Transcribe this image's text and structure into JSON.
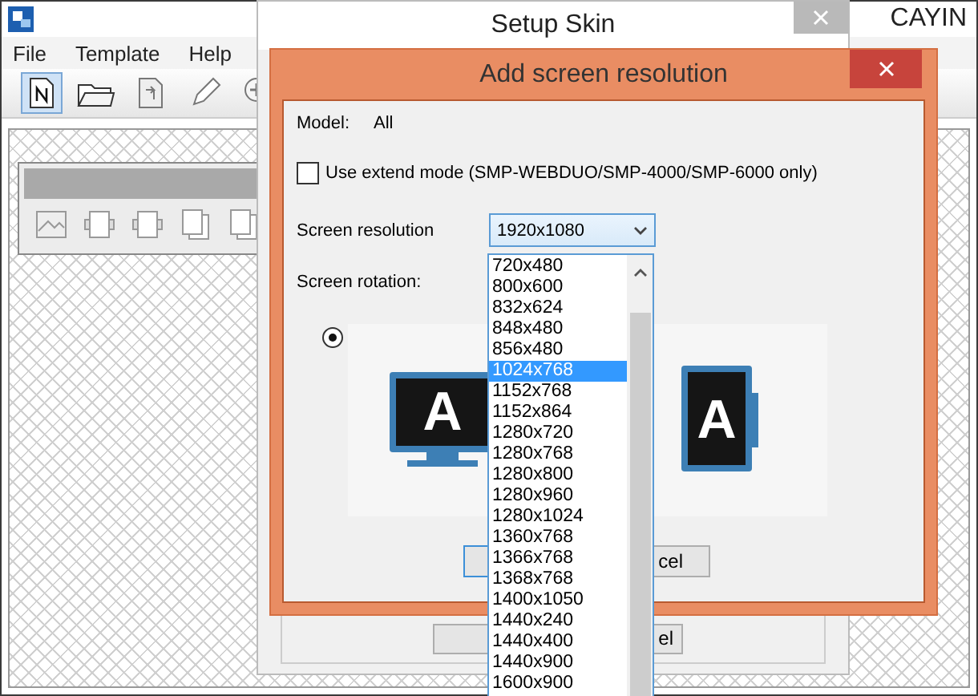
{
  "main_window": {
    "title": "CAYIN",
    "menu": [
      "File",
      "Template",
      "Help"
    ]
  },
  "setup_skin": {
    "title": "Setup Skin",
    "button_text": "el"
  },
  "dialog": {
    "title": "Add screen resolution",
    "model_label": "Model:",
    "model_value": "All",
    "extend_mode": {
      "label": "Use extend mode (SMP-WEBDUO/SMP-4000/SMP-6000 only)",
      "checked": false
    },
    "resolution_label": "Screen resolution",
    "resolution_value": "1920x1080",
    "rotation_label": "Screen rotation:",
    "landscape_selected": true,
    "monitors": [
      {
        "kind": "landscape",
        "letter": "A"
      },
      {
        "kind": "portrait",
        "letter": "A"
      }
    ],
    "cancel_text": "cel"
  },
  "dropdown": {
    "items": [
      {
        "label": "720x480",
        "selected": false
      },
      {
        "label": "800x600",
        "selected": false
      },
      {
        "label": "832x624",
        "selected": false
      },
      {
        "label": "848x480",
        "selected": false
      },
      {
        "label": "856x480",
        "selected": false
      },
      {
        "label": "1024x768",
        "selected": true
      },
      {
        "label": "1152x768",
        "selected": false
      },
      {
        "label": "1152x864",
        "selected": false
      },
      {
        "label": "1280x720",
        "selected": false
      },
      {
        "label": "1280x768",
        "selected": false
      },
      {
        "label": "1280x800",
        "selected": false
      },
      {
        "label": "1280x960",
        "selected": false
      },
      {
        "label": "1280x1024",
        "selected": false
      },
      {
        "label": "1360x768",
        "selected": false
      },
      {
        "label": "1366x768",
        "selected": false
      },
      {
        "label": "1368x768",
        "selected": false
      },
      {
        "label": "1400x1050",
        "selected": false
      },
      {
        "label": "1440x240",
        "selected": false
      },
      {
        "label": "1440x400",
        "selected": false
      },
      {
        "label": "1440x900",
        "selected": false
      },
      {
        "label": "1600x900",
        "selected": false
      }
    ]
  }
}
